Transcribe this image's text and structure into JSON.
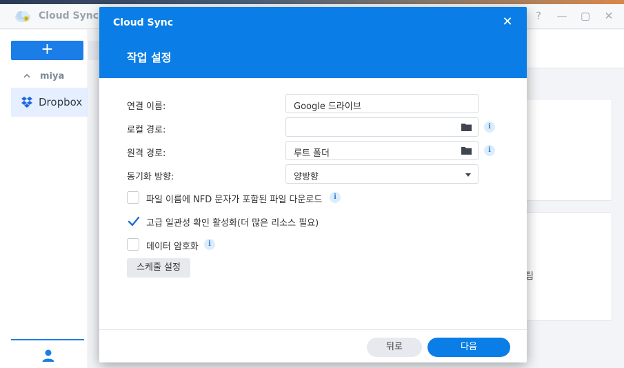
{
  "app": {
    "title": "Cloud Sync",
    "window_controls": [
      "?",
      "—",
      "▢",
      "✕"
    ],
    "sidebar": {
      "add_label": "+",
      "group": "miya",
      "items": [
        {
          "label": "Dropbox",
          "icon": "dropbox-icon"
        }
      ]
    },
    "background_text": "팀"
  },
  "modal": {
    "app_name": "Cloud Sync",
    "close_label": "✕",
    "title": "작업 설정",
    "rows": {
      "connection_name": {
        "label": "연결 이름:",
        "value": "Google 드라이브"
      },
      "local_path": {
        "label": "로컬 경로:",
        "value": ""
      },
      "remote_path": {
        "label": "원격 경로:",
        "value": "루트 폴더"
      },
      "sync_direction": {
        "label": "동기화 방향:",
        "value": "양방향"
      }
    },
    "options": {
      "nfd": {
        "label": "파일 이름에 NFD 문자가 포함된 파일 다운로드",
        "checked": false
      },
      "consistency": {
        "label": "고급 일관성 확인 활성화(더 많은 리소스 필요)",
        "checked": true
      },
      "encrypt": {
        "label": "데이터 암호화",
        "checked": false
      }
    },
    "info_glyph": "i",
    "schedule_label": "스케줄 설정",
    "back_label": "뒤로",
    "next_label": "다음"
  },
  "colors": {
    "accent": "#0a7ee6",
    "info_bg": "#dcecfb"
  }
}
